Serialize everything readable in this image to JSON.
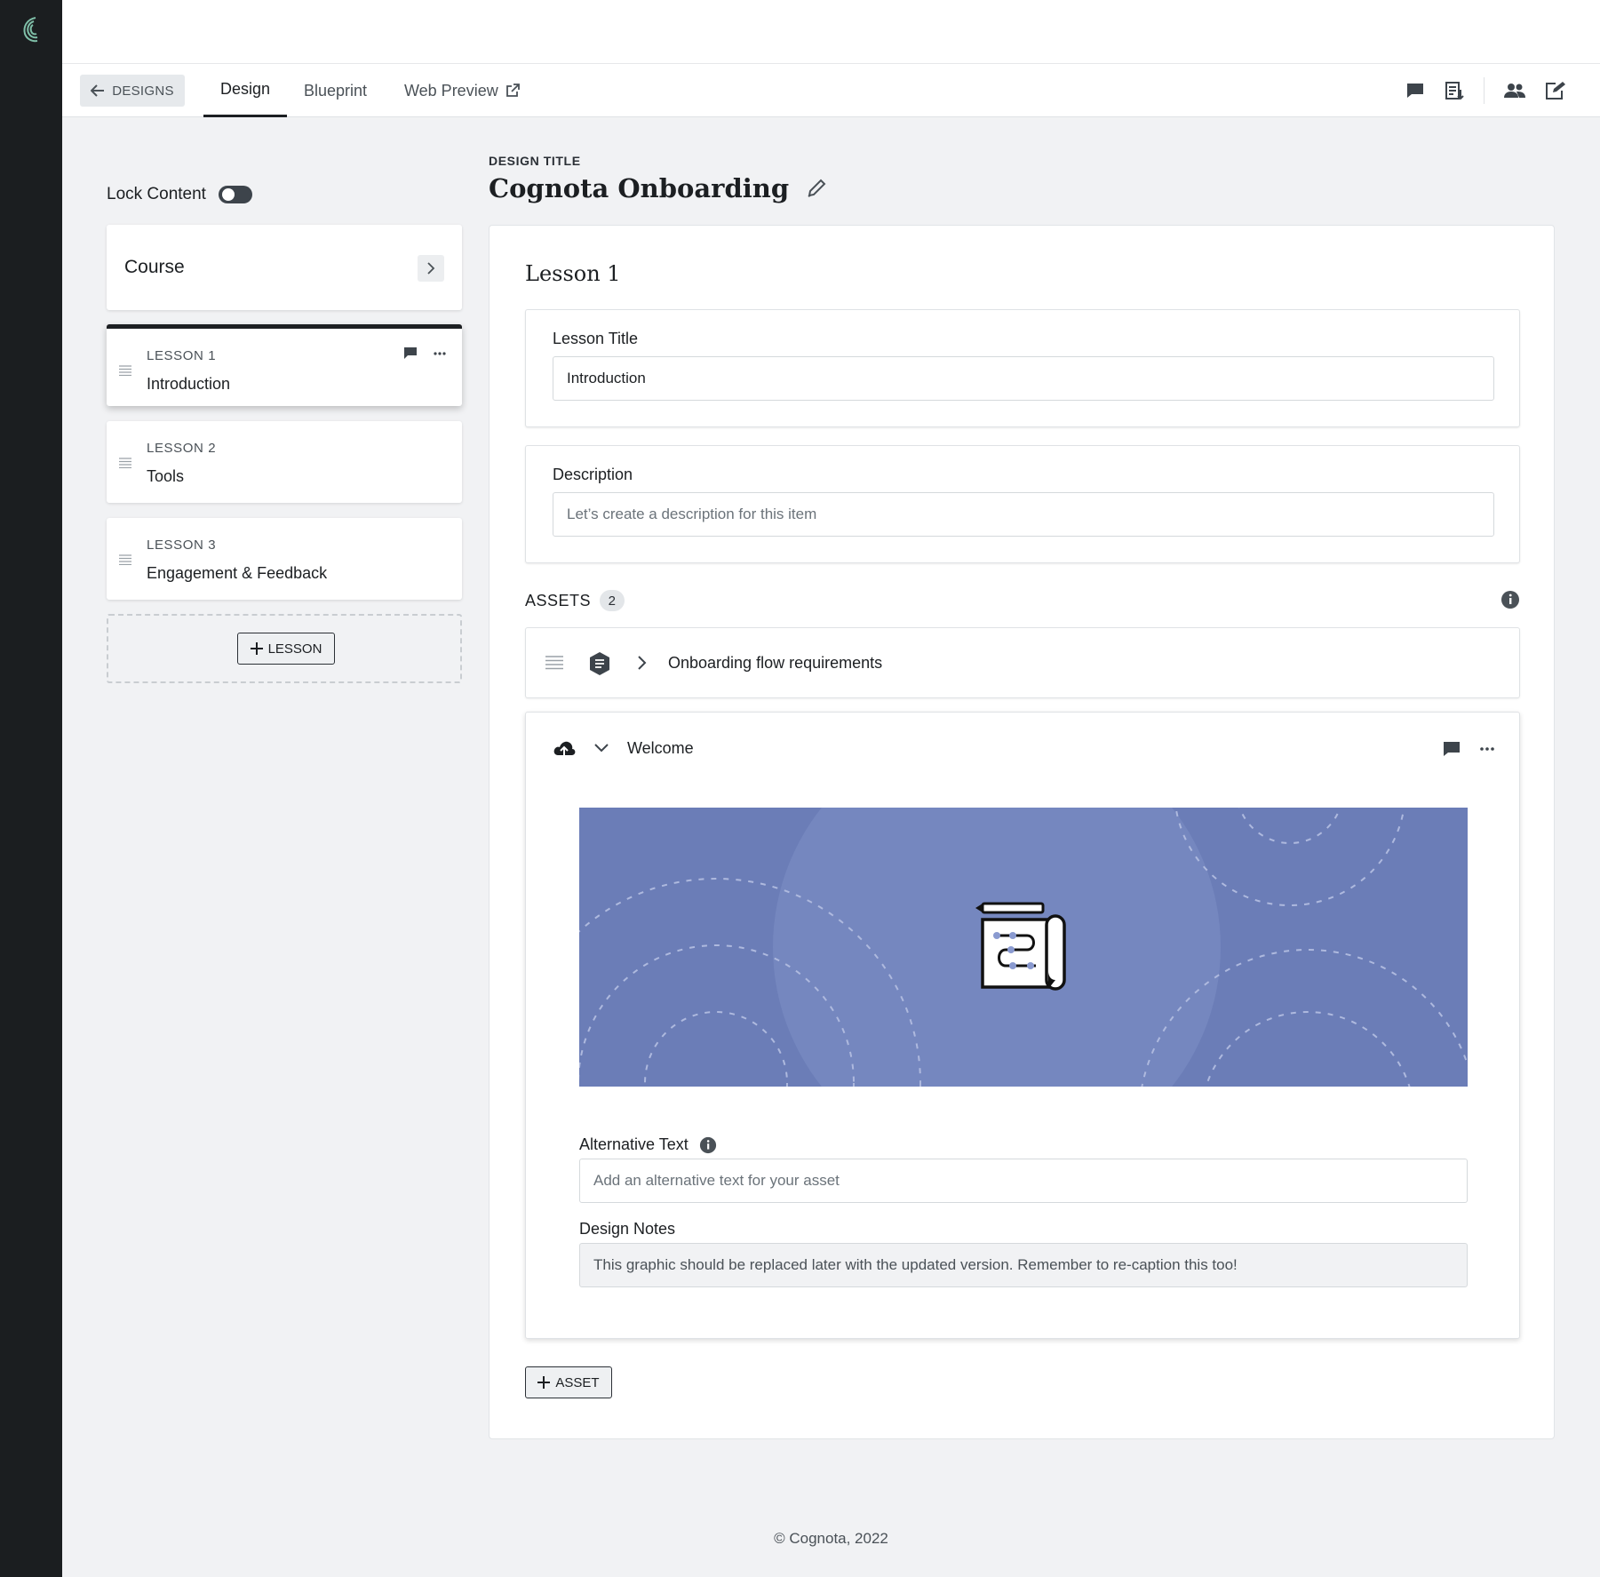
{
  "colors": {
    "sidebar": "#1b1e20",
    "accent": "#1c1f22",
    "hero": "#6b7db7",
    "logo": "#7fbfa8"
  },
  "nav": {
    "back_label": "DESIGNS",
    "tabs": [
      {
        "label": "Design",
        "active": true
      },
      {
        "label": "Blueprint",
        "active": false
      },
      {
        "label": "Web Preview",
        "active": false
      }
    ],
    "icons": [
      "comment-icon",
      "export-icon",
      "people-icon",
      "edit-note-icon"
    ]
  },
  "left": {
    "lock_label": "Lock Content",
    "lock_on": false,
    "course_label": "Course",
    "lessons": [
      {
        "number": "LESSON 1",
        "name": "Introduction",
        "active": true
      },
      {
        "number": "LESSON 2",
        "name": "Tools",
        "active": false
      },
      {
        "number": "LESSON 3",
        "name": "Engagement & Feedback",
        "active": false
      }
    ],
    "add_lesson_label": "LESSON"
  },
  "design": {
    "title_label": "DESIGN TITLE",
    "title": "Cognota Onboarding"
  },
  "lesson": {
    "heading": "Lesson 1",
    "title_label": "Lesson Title",
    "title_value": "Introduction",
    "description_label": "Description",
    "description_placeholder": "Let’s create a description for this item",
    "assets_label": "ASSETS",
    "assets_count": "2",
    "assets": [
      {
        "name": "Onboarding flow requirements",
        "expanded": false
      },
      {
        "name": "Welcome",
        "expanded": true,
        "alt_label": "Alternative Text",
        "alt_placeholder": "Add an alternative text for your asset",
        "notes_label": "Design Notes",
        "notes_value": "This graphic should be replaced later with the updated version. Remember to re-caption this too!"
      }
    ],
    "add_asset_label": "ASSET"
  },
  "footer": "© Cognota, 2022"
}
